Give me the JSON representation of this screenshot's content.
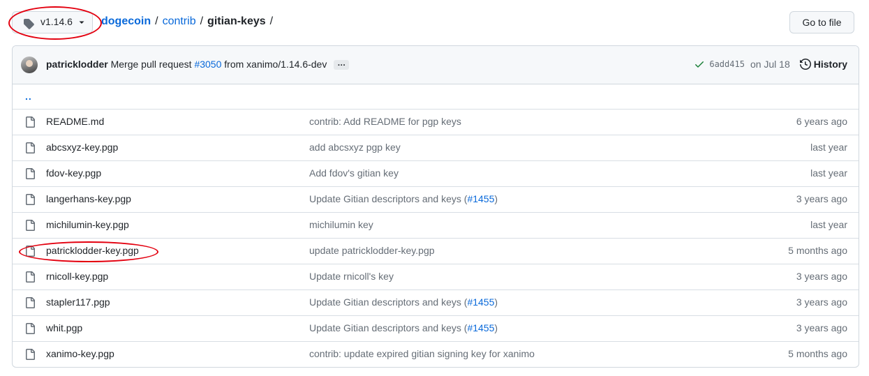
{
  "branch": {
    "label": "v1.14.6",
    "icon": "tag-icon"
  },
  "breadcrumb": {
    "root": "dogecoin",
    "sep1": "/",
    "mid": "contrib",
    "sep2": "/",
    "current": "gitian-keys",
    "sep3": "/"
  },
  "goto_file": "Go to file",
  "commit": {
    "author": "patricklodder",
    "message_pre": "Merge pull request",
    "pr": "#3050",
    "message_post": "from xanimo/1.14.6-dev",
    "ellipsis": "…",
    "sha": "6add415",
    "date": "on Jul 18",
    "history": "History"
  },
  "parent_link": "..",
  "files": [
    {
      "name": "README.md",
      "msg": "contrib: Add README for pgp keys",
      "pr": "",
      "age": "6 years ago"
    },
    {
      "name": "abcsxyz-key.pgp",
      "msg": "add abcsxyz pgp key",
      "pr": "",
      "age": "last year"
    },
    {
      "name": "fdov-key.pgp",
      "msg": "Add fdov's gitian key",
      "pr": "",
      "age": "last year"
    },
    {
      "name": "langerhans-key.pgp",
      "msg": "Update Gitian descriptors and keys (",
      "pr": "#1455",
      "msg_end": ")",
      "age": "3 years ago"
    },
    {
      "name": "michilumin-key.pgp",
      "msg": "michilumin key",
      "pr": "",
      "age": "last year"
    },
    {
      "name": "patricklodder-key.pgp",
      "msg": "update patricklodder-key.pgp",
      "pr": "",
      "age": "5 months ago"
    },
    {
      "name": "rnicoll-key.pgp",
      "msg": "Update rnicoll's key",
      "pr": "",
      "age": "3 years ago"
    },
    {
      "name": "stapler117.pgp",
      "msg": "Update Gitian descriptors and keys (",
      "pr": "#1455",
      "msg_end": ")",
      "age": "3 years ago"
    },
    {
      "name": "whit.pgp",
      "msg": "Update Gitian descriptors and keys (",
      "pr": "#1455",
      "msg_end": ")",
      "age": "3 years ago"
    },
    {
      "name": "xanimo-key.pgp",
      "msg": "contrib: update expired gitian signing key for xanimo",
      "pr": "",
      "age": "5 months ago"
    }
  ],
  "colors": {
    "link": "#0969da",
    "annotation": "#e3000f",
    "success": "#1a7f37",
    "muted": "#656d76"
  }
}
